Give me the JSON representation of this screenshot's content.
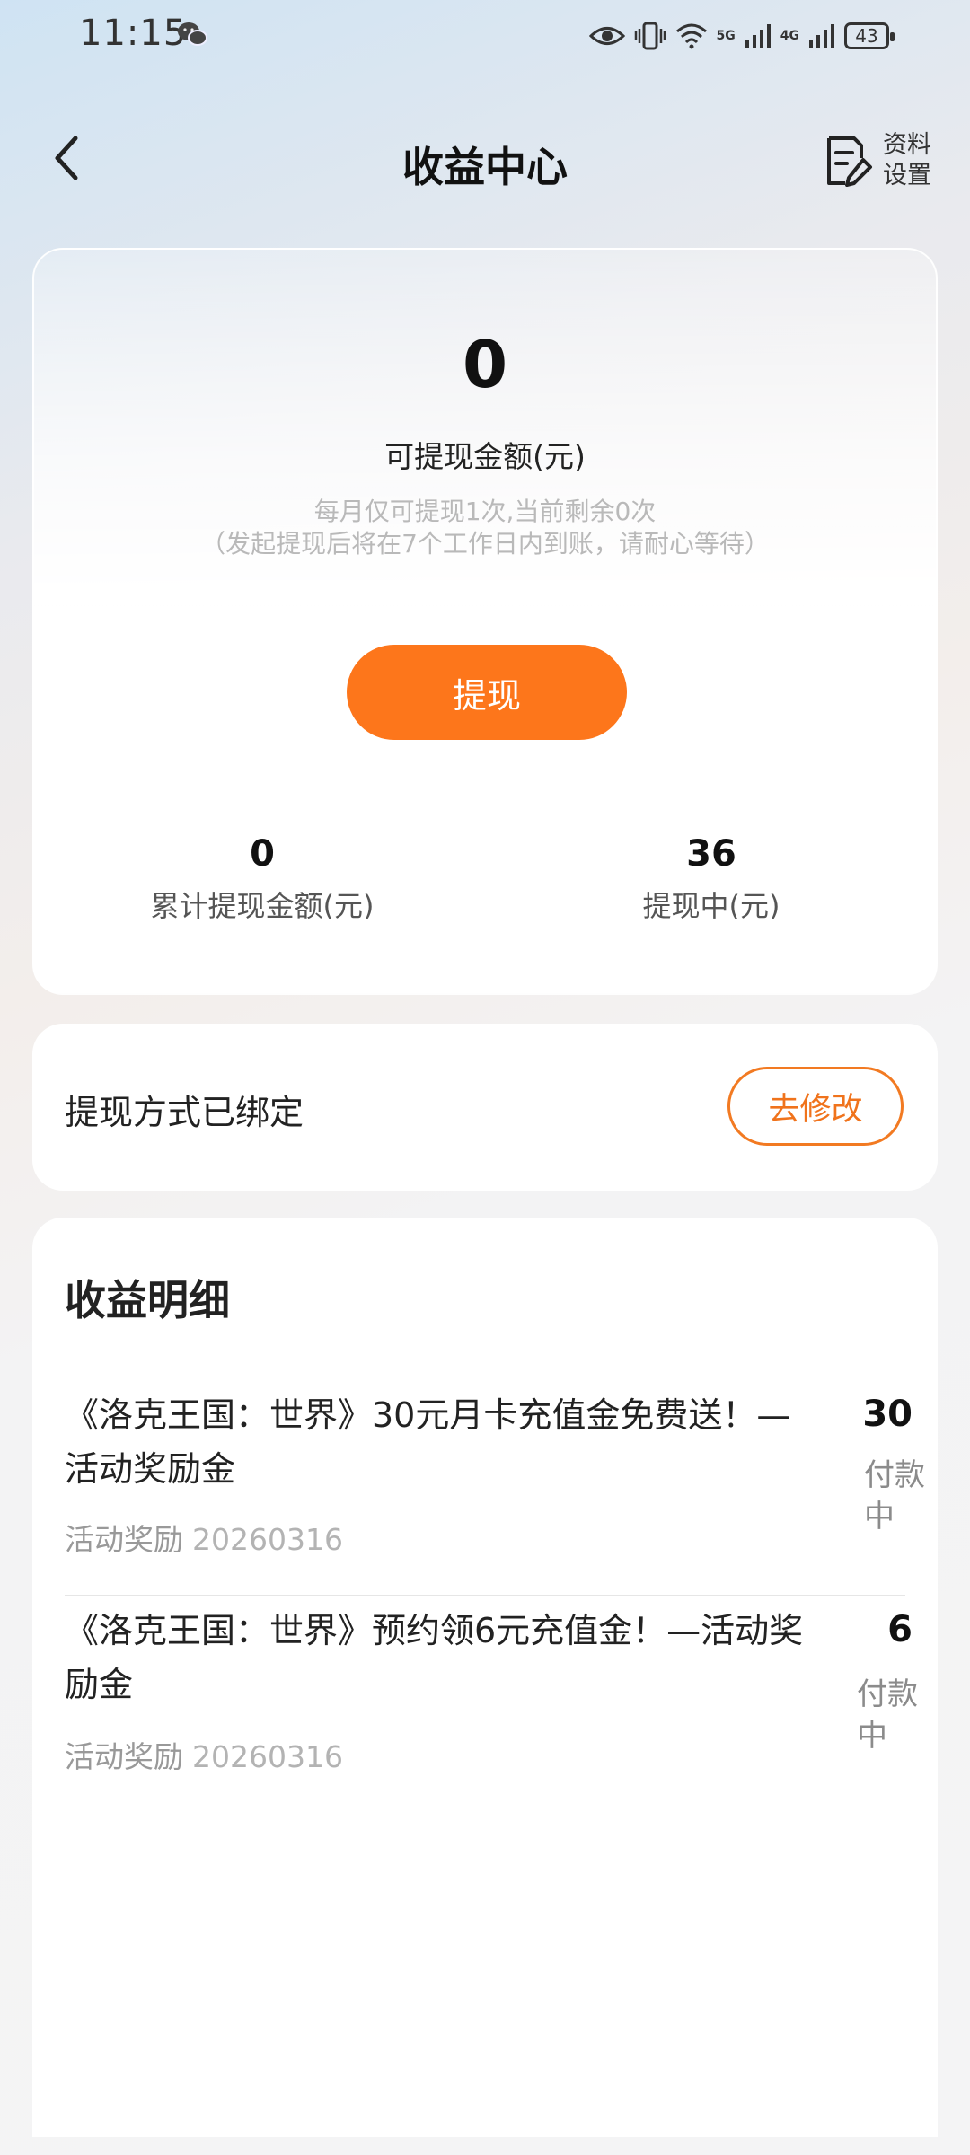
{
  "status_bar": {
    "time": "11:15",
    "net1": "5G",
    "net2": "4G",
    "battery": "43"
  },
  "header": {
    "title": "收益中心",
    "profile_settings": "资料设置"
  },
  "balance": {
    "amount": "0",
    "label": "可提现金额(元)",
    "hint1": "每月仅可提现1次,当前剩余0次",
    "hint2": "（发起提现后将在7个工作日内到账，请耐心等待）",
    "withdraw_button": "提现",
    "stats": [
      {
        "value": "0",
        "label": "累计提现金额(元)"
      },
      {
        "value": "36",
        "label": "提现中(元)"
      }
    ]
  },
  "withdraw_method": {
    "label": "提现方式已绑定",
    "modify_button": "去修改"
  },
  "details": {
    "title": "收益明细",
    "entries": [
      {
        "title": "《洛克王国：世界》30元月卡充值金免费送！—活动奖励金",
        "category": "活动奖励",
        "date": "20260316",
        "amount": "30",
        "status": "付款中"
      },
      {
        "title": "《洛克王国：世界》预约领6元充值金！—活动奖励金",
        "category": "活动奖励",
        "date": "20260316",
        "amount": "6",
        "status": "付款中"
      }
    ]
  },
  "colors": {
    "accent": "#fd761b",
    "accent_outline": "#f27a22"
  }
}
